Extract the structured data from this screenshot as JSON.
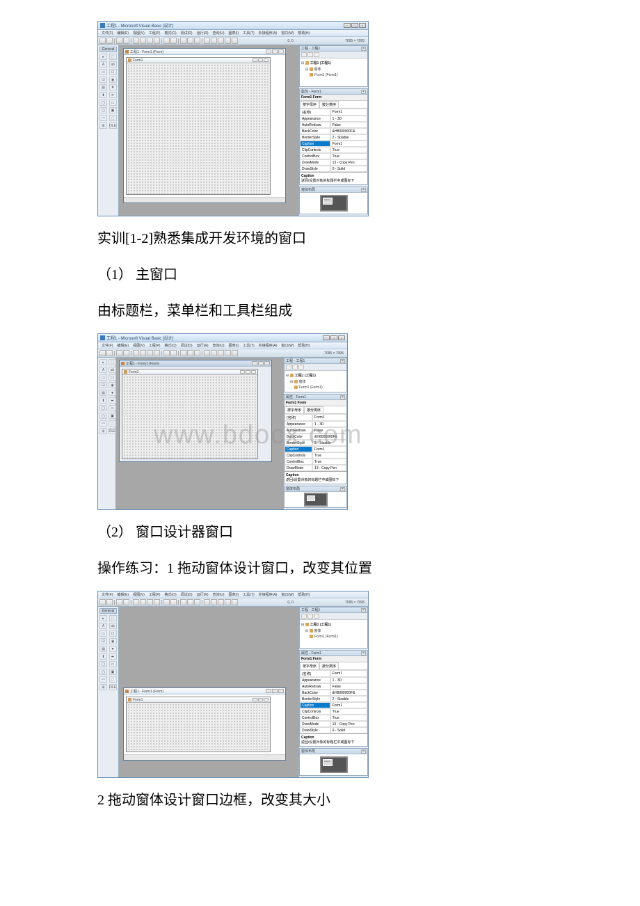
{
  "text": {
    "training_label": "实训[1-2]熟悉集成开发环境的窗口",
    "section1_num": "（1） 主窗口",
    "section1_desc": "由标题栏，菜单栏和工具栏组成",
    "section2_num": "（2） 窗口设计器窗口",
    "section2_desc": "操作练习：1 拖动窗体设计窗口，改变其位置",
    "footer_text": "2 拖动窗体设计窗口边框，改变其大小"
  },
  "watermark": "www.bdocx.com",
  "vb": {
    "title": "工程1 - Microsoft Visual Basic [设计]",
    "coords": "0, 0",
    "size": "7095 × 7095",
    "menu": [
      "文件(F)",
      "编辑(E)",
      "视图(V)",
      "工程(P)",
      "格式(O)",
      "调试(D)",
      "运行(R)",
      "查询(U)",
      "图表(I)",
      "工具(T)",
      "外接程序(A)",
      "窗口(W)",
      "帮助(H)"
    ],
    "toolbox_title": "General",
    "toolbox_items": [
      "▸",
      "⬚",
      "A",
      "ab",
      "▭",
      "☐",
      "☑",
      "◉",
      "▤",
      "▼",
      "⬍",
      "⬌",
      "◯",
      "▭",
      "▢",
      "▣",
      "〰",
      "⬚",
      "⊞",
      "OLE"
    ],
    "designer_title": "工程1 - Form1 (Form)",
    "form_title": "Form1",
    "project_pane_title": "工程 - 工程1",
    "tree_root": "工程1 (工程1)",
    "tree_folder": "窗体",
    "tree_item": "Form1 (Form1)",
    "props_pane_title": "属性 - Form1",
    "props_header": "Form1 Form",
    "props_tabs": [
      "按字母序",
      "按分类序"
    ],
    "props": [
      {
        "name": "(名称)",
        "value": "Form1"
      },
      {
        "name": "Appearance",
        "value": "1 - 3D"
      },
      {
        "name": "AutoRedraw",
        "value": "False"
      },
      {
        "name": "BackColor",
        "value": "&H8000000F&"
      },
      {
        "name": "BorderStyle",
        "value": "2 - Sizable"
      },
      {
        "name": "Caption",
        "value": "Form1"
      },
      {
        "name": "ClipControls",
        "value": "True"
      },
      {
        "name": "ControlBox",
        "value": "True"
      },
      {
        "name": "DrawMode",
        "value": "13 - Copy Pen"
      },
      {
        "name": "DrawStyle",
        "value": "0 - Solid"
      }
    ],
    "props_desc_title": "Caption",
    "props_desc_body": "返回/设置对象的标题栏中或图标下",
    "layout_pane_title": "窗体布局",
    "layout_form_label": "Form1"
  }
}
